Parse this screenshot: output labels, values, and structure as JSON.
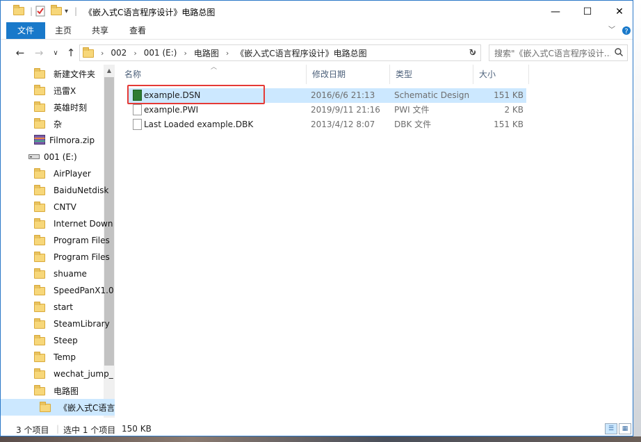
{
  "window": {
    "title": "《嵌入式C语言程序设计》电路总图"
  },
  "ribbon": {
    "tabs": [
      "文件",
      "主页",
      "共享",
      "查看"
    ]
  },
  "address": {
    "crumbs": [
      "002",
      "001 (E:)",
      "电路图",
      "《嵌入式C语言程序设计》电路总图"
    ]
  },
  "search": {
    "placeholder": "搜索\"《嵌入式C语言程序设计..."
  },
  "nav": {
    "items": [
      {
        "label": "新建文件夹",
        "icon": "folder-icon"
      },
      {
        "label": "迅雷X",
        "icon": "folder-icon"
      },
      {
        "label": "英雄时刻",
        "icon": "folder-icon"
      },
      {
        "label": "杂",
        "icon": "folder-icon"
      },
      {
        "label": "Filmora.zip",
        "icon": "zip-archive-icon"
      },
      {
        "label": "001 (E:)",
        "icon": "drive-icon"
      },
      {
        "label": "AirPlayer",
        "icon": "folder-icon"
      },
      {
        "label": "BaiduNetdisk",
        "icon": "folder-icon"
      },
      {
        "label": "CNTV",
        "icon": "folder-icon"
      },
      {
        "label": "Internet Down",
        "icon": "folder-icon"
      },
      {
        "label": "Program Files",
        "icon": "folder-icon"
      },
      {
        "label": "Program Files",
        "icon": "folder-icon"
      },
      {
        "label": "shuame",
        "icon": "folder-icon"
      },
      {
        "label": "SpeedPanX1.0",
        "icon": "folder-icon"
      },
      {
        "label": "start",
        "icon": "folder-icon"
      },
      {
        "label": "SteamLibrary",
        "icon": "folder-icon"
      },
      {
        "label": "Steep",
        "icon": "folder-icon"
      },
      {
        "label": "Temp",
        "icon": "folder-icon"
      },
      {
        "label": "wechat_jump_",
        "icon": "folder-icon"
      },
      {
        "label": "电路图",
        "icon": "folder-icon"
      },
      {
        "label": "《嵌入式C语言",
        "icon": "folder-icon"
      }
    ]
  },
  "columns": {
    "name": "名称",
    "date": "修改日期",
    "type": "类型",
    "size": "大小"
  },
  "files": [
    {
      "name": "example.DSN",
      "date": "2016/6/6 21:13",
      "type": "Schematic Design",
      "size": "151 KB",
      "icon": "dsn-file-icon"
    },
    {
      "name": "example.PWI",
      "date": "2019/9/11 21:16",
      "type": "PWI 文件",
      "size": "2 KB",
      "icon": "blank-file-icon"
    },
    {
      "name": "Last Loaded example.DBK",
      "date": "2013/4/12 8:07",
      "type": "DBK 文件",
      "size": "151 KB",
      "icon": "blank-file-icon"
    }
  ],
  "status": {
    "count": "3 个项目",
    "selected": "选中 1 个项目",
    "size": "150 KB"
  }
}
